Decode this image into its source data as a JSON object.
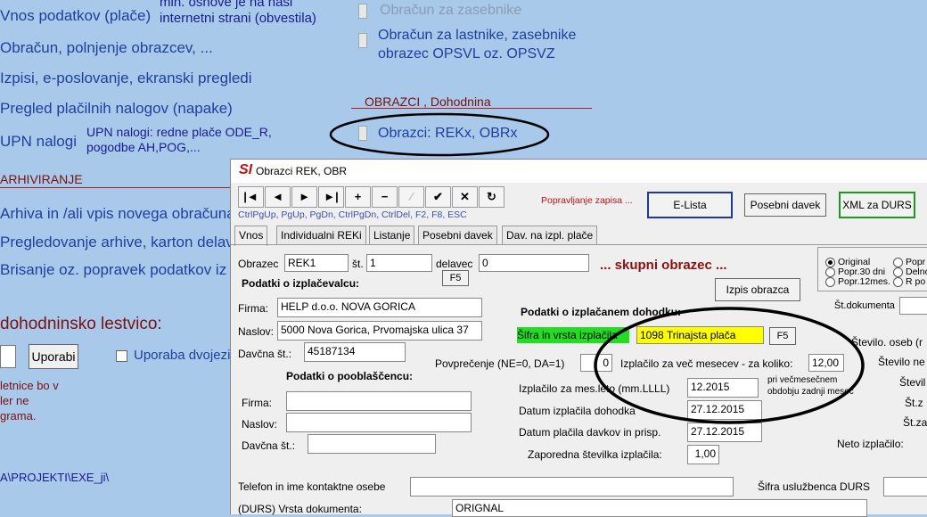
{
  "bg_menu": {
    "vnos": "Vnos podatkov (plače)",
    "min_osnove": "min. osnove  je na naši",
    "internetni": "internetni strani (obvestila)",
    "obracun_polnjenje": "Obračun, polnjenje obrazcev, ...",
    "izpisi": "Izpisi, e-poslovanje, ekranski pregledi",
    "pregled_nalogov": "Pregled plačilnih nalogov (napake)",
    "upn_nalogi": "UPN nalogi",
    "upn_desc1": "UPN nalogi: redne plače ODE_R,",
    "upn_desc2": "pogodbe AH,POG,...",
    "arhiviranje": "ARHIVIRANJE",
    "arhiva": "Arhiva in /ali vpis novega obračuna",
    "pregledovanje": "Pregledovanje arhive, karton delavc",
    "brisanje": "Brisanje oz. popravek podatkov iz a",
    "dohodninsko": "dohodninsko lestvico:",
    "uporabi": "Uporabi",
    "uporaba_dvojezic": "Uporaba dvojezic",
    "note1": "letnice bo v",
    "note2": "ler ne",
    "note3": "grama.",
    "path": "A\\PROJEKTI\\EXE_ji\\",
    "obracun_zasebnike": "Obračun za zasebnike",
    "obracun_lastnike1": "Obračun za lastnike, zasebnike",
    "obracun_lastnike2": "obrazec OPSVL oz. OPSVZ",
    "obrazci_dohodnina": "OBRAZCI ,   Dohodnina",
    "obrazci_rek": "Obrazci: REKx, OBRx"
  },
  "dialog": {
    "title": "Obrazci REK, OBR",
    "toolbar": [
      "|◄",
      "◄",
      "►",
      "►|",
      "+",
      "−",
      "⁄",
      "✔",
      "✕",
      "↻"
    ],
    "toolbar_hint": "CtrlPgUp, PgUp, PgDn, CtrlPgDn,  CtrlDel,  F2,     F8,     ESC",
    "popravljanje": "Popravljanje zapisa ...",
    "e_lista": "E-Lista",
    "posebni_davek_btn": "Posebni davek",
    "xml_durs": "XML za DURS",
    "tabs": [
      "Vnos",
      "Individualni REKi",
      "Listanje",
      "Posebni davek",
      "Dav. na izpl. plače"
    ],
    "obrazec_label": "Obrazec",
    "obrazec_value": "REK1",
    "st_label": "št.",
    "st_value": "1",
    "delavec_label": "delavec",
    "delavec_value": "0",
    "f5": "F5",
    "skupni": "... skupni obrazec ...",
    "radio_original": "Original",
    "radio_popr30": "Popr.30 dni",
    "radio_popr12": "Popr.12mes.",
    "radio_popr": "Popr",
    "radio_delno": "Delno",
    "radio_r_po": "R po",
    "izpis_obrazca": "Izpis  obrazca",
    "st_dokumenta": "Št.dokumenta",
    "podatki_izplacevalcu": "Podatki o izplačevalcu:",
    "firma_label": "Firma:",
    "firma_value": "HELP d.o.o. NOVA GORICA",
    "naslov_label": "Naslov:",
    "naslov_value": "5000 Nova Gorica, Prvomajska ulica 37",
    "davcna_label": "Davčna št.:",
    "davcna_value": "45187134",
    "podatki_dohodku": "Podatki o izplačanem dohodku:",
    "sifra_vrsta": "Šifra in vrsta izplačila",
    "sifra_value": "1098 Trinajsta plača",
    "f5b": "F5",
    "stevilo_oseb": "Število. oseb (r",
    "stevilo_ne": "Število ne",
    "stevil": "Števil",
    "st_z1": "Št.z",
    "st_z2": "Št.za",
    "neto": "Neto izplačilo:",
    "povprecenje_label": "Povprečenje (NE=0, DA=1)",
    "povprecenje_value": "0",
    "izplacilo_vec_label": "Izplačilo za več mesecev - za koliko:",
    "izplacilo_vec_value": "12,00",
    "mes_leto_label": "Izplačilo za mes.leto (mm.LLLL)",
    "mes_leto_value": "12.2015",
    "pri_vecmesecnem1": "pri večmesečnem",
    "pri_vecmesecnem2": "obdobju zadnji mesec",
    "datum_izplacila_label": "Datum izplačila dohodka",
    "datum_izplacila_value": "27.12.2015",
    "datum_placila_label": "Datum plačila davkov in prisp.",
    "datum_placila_value": "27.12.2015",
    "zaporedna_label": "Zaporedna številka izplačila:",
    "zaporedna_value": "1,00",
    "podatki_pooblascencu": "Podatki o pooblaščencu:",
    "firma2_label": "Firma:",
    "naslov2_label": "Naslov:",
    "davcna2_label": "Davčna št.:",
    "telefon_label": "Telefon in ime kontaktne osebe",
    "sifra_usluzbenca": "Šifra uslužbenca DURS",
    "vrsta_dok_label": "(DURS) Vrsta dokumenta:",
    "vrsta_dok_value": "ORIGNAL"
  },
  "colors": {
    "bg": "#a9c9ea",
    "menu_text": "#1f3fa0",
    "accent_red": "#b02020",
    "green_field": "#22dd22",
    "yellow_field": "#ffff00"
  }
}
